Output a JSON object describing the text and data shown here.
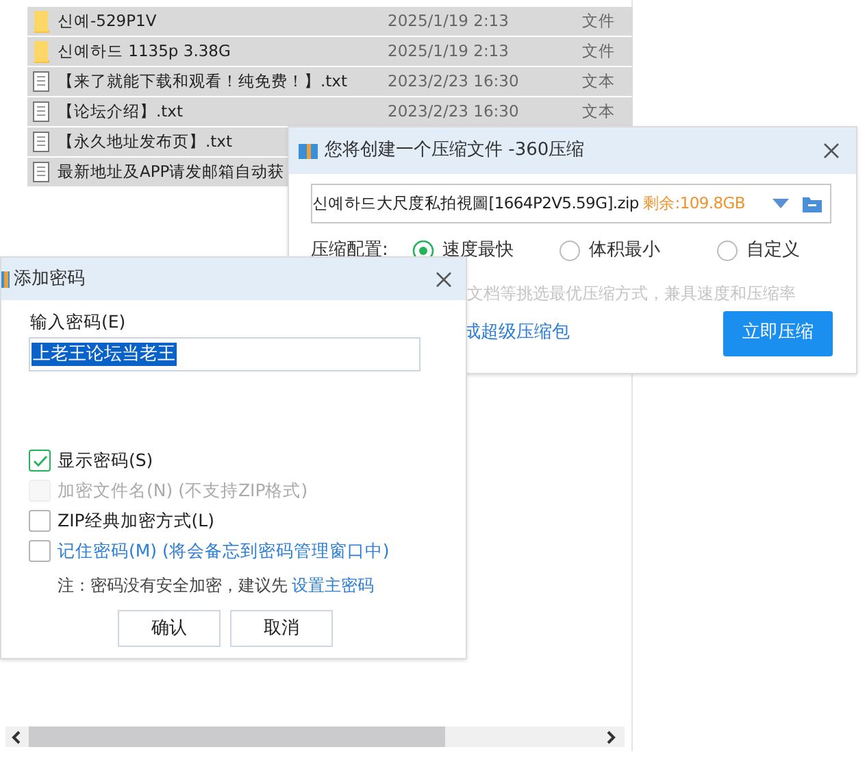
{
  "explorer": {
    "files": [
      {
        "kind": "folder",
        "name": "신예-529P1V",
        "date": "2025/1/19 2:13",
        "type": "文件"
      },
      {
        "kind": "folder",
        "name": "신예하드 1135p 3.38G",
        "date": "2025/1/19 2:13",
        "type": "文件"
      },
      {
        "kind": "text",
        "name": "【来了就能下载和观看！纯免费！】.txt",
        "date": "2023/2/23 16:30",
        "type": "文本"
      },
      {
        "kind": "text",
        "name": "【论坛介绍】.txt",
        "date": "2023/2/23 16:30",
        "type": "文本"
      },
      {
        "kind": "text",
        "name": "【永久地址发布页】.txt"
      },
      {
        "kind": "text",
        "name": "最新地址及APP请发邮箱自动获"
      }
    ]
  },
  "compress_dialog": {
    "title": "您将创建一个压缩文件 -360压缩",
    "path": "신예하드大尺度私拍視圖[1664P2V5.59G].zip",
    "free_space": "剩余:109.8GB",
    "config_label": "压缩配置:",
    "options": [
      {
        "label": "速度最快",
        "selected": true
      },
      {
        "label": "体积最小",
        "selected": false
      },
      {
        "label": "自定义",
        "selected": false
      }
    ],
    "hint": "文档等挑选最优压缩方式，兼具速度和压缩率",
    "link": "成超级压缩包",
    "button": "立即压缩"
  },
  "password_dialog": {
    "title": "添加密码",
    "field_label": "输入密码(E)",
    "password": "上老王论坛当老王",
    "checkboxes": [
      {
        "kind": "plain",
        "label": "显示密码(S)",
        "checked": true,
        "disabled": false
      },
      {
        "kind": "plain",
        "label": "加密文件名(N) (不支持ZIP格式)",
        "checked": false,
        "disabled": true
      },
      {
        "kind": "plain",
        "label": "ZIP经典加密方式(L)",
        "checked": false,
        "disabled": false
      },
      {
        "kind": "link",
        "label": "记住密码(M) (将会备忘到密码管理窗口中)",
        "checked": false,
        "disabled": false
      }
    ],
    "note": "注：密码没有安全加密，建议先",
    "note_link": "设置主密码",
    "buttons": [
      "确认",
      "取消"
    ]
  }
}
